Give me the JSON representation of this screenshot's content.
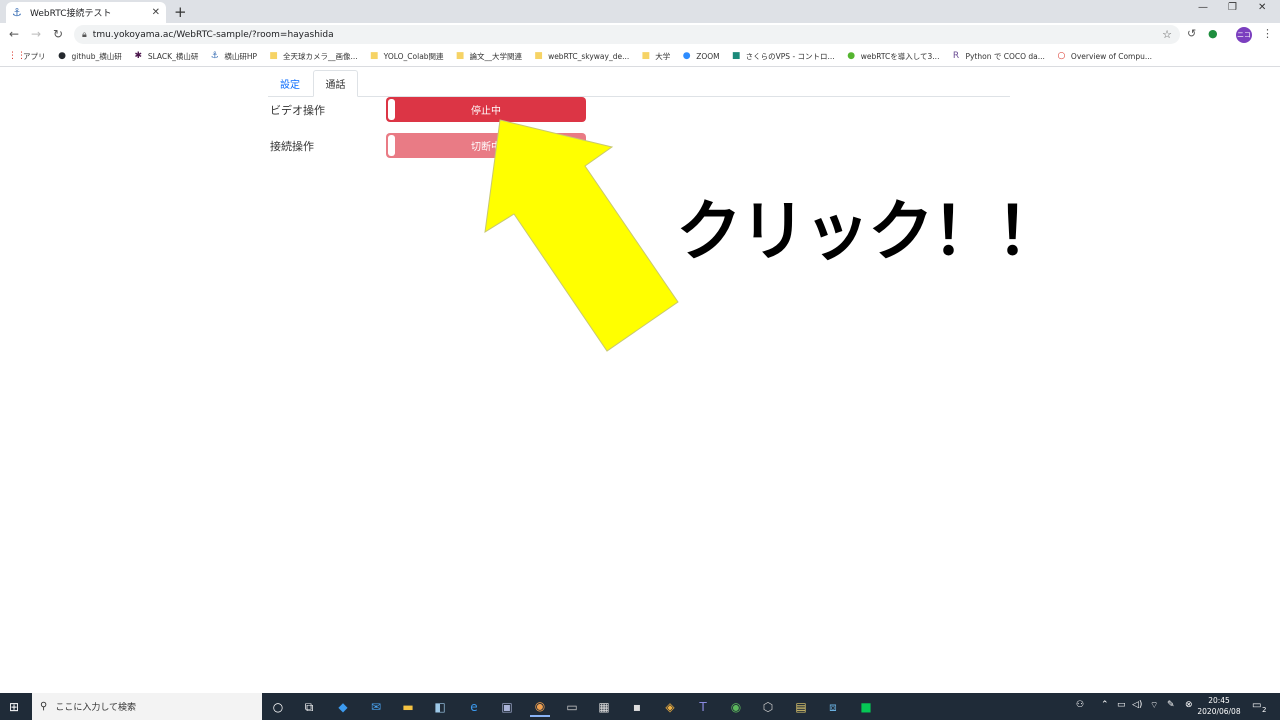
{
  "browser": {
    "tab_title": "WebRTC接続テスト",
    "tab_close": "✕",
    "new_tab": "+",
    "url": "tmu.yokoyama.ac/WebRTC-sample/?room=hayashida",
    "avatar_text": "ニコ"
  },
  "bookmarks": [
    {
      "label": "アプリ",
      "icon": "apps-icon",
      "glyph": "⋮⋮",
      "color": "#d93025"
    },
    {
      "label": "github_横山研",
      "icon": "github-icon",
      "glyph": "●",
      "color": "#24292e"
    },
    {
      "label": "SLACK_横山研",
      "icon": "slack-icon",
      "glyph": "✱",
      "color": "#4a154b"
    },
    {
      "label": "横山研HP",
      "icon": "anchor-icon",
      "glyph": "⚓",
      "color": "#3a6fb5"
    },
    {
      "label": "全天球カメラ__画像...",
      "icon": "folder-icon",
      "glyph": "■",
      "color": "#f6d365"
    },
    {
      "label": "YOLO_Colab関連",
      "icon": "folder-icon",
      "glyph": "■",
      "color": "#f6d365"
    },
    {
      "label": "論文__大学関連",
      "icon": "folder-icon",
      "glyph": "■",
      "color": "#f6d365"
    },
    {
      "label": "webRTC_skyway_de...",
      "icon": "folder-icon",
      "glyph": "■",
      "color": "#f6d365"
    },
    {
      "label": "大学",
      "icon": "folder-icon",
      "glyph": "■",
      "color": "#f6d365"
    },
    {
      "label": "ZOOM",
      "icon": "zoom-icon",
      "glyph": "●",
      "color": "#2d8cff"
    },
    {
      "label": "さくらのVPS - コントロ...",
      "icon": "sakura-icon",
      "glyph": "■",
      "color": "#1b8a7a"
    },
    {
      "label": "webRTCを導入して3...",
      "icon": "webrtc-icon",
      "glyph": "●",
      "color": "#55b530"
    },
    {
      "label": "Python で COCO da...",
      "icon": "r-icon",
      "glyph": "R",
      "color": "#6a4c93"
    },
    {
      "label": "Overview of Compu...",
      "icon": "circle-icon",
      "glyph": "○",
      "color": "#d93025"
    }
  ],
  "page": {
    "tabs": [
      {
        "label": "設定",
        "active": false
      },
      {
        "label": "通話",
        "active": true
      }
    ],
    "rows": [
      {
        "label": "ビデオ操作",
        "button": "停止中",
        "color": "#dc3545"
      },
      {
        "label": "接続操作",
        "button": "切断中",
        "color": "#e97b85"
      }
    ]
  },
  "annotation": {
    "text": "クリック！！",
    "arrow_color": "#ffff00"
  },
  "taskbar": {
    "search_placeholder": "ここに入力して検索",
    "time": "20:45",
    "date": "2020/06/08",
    "notification_count": "2"
  }
}
